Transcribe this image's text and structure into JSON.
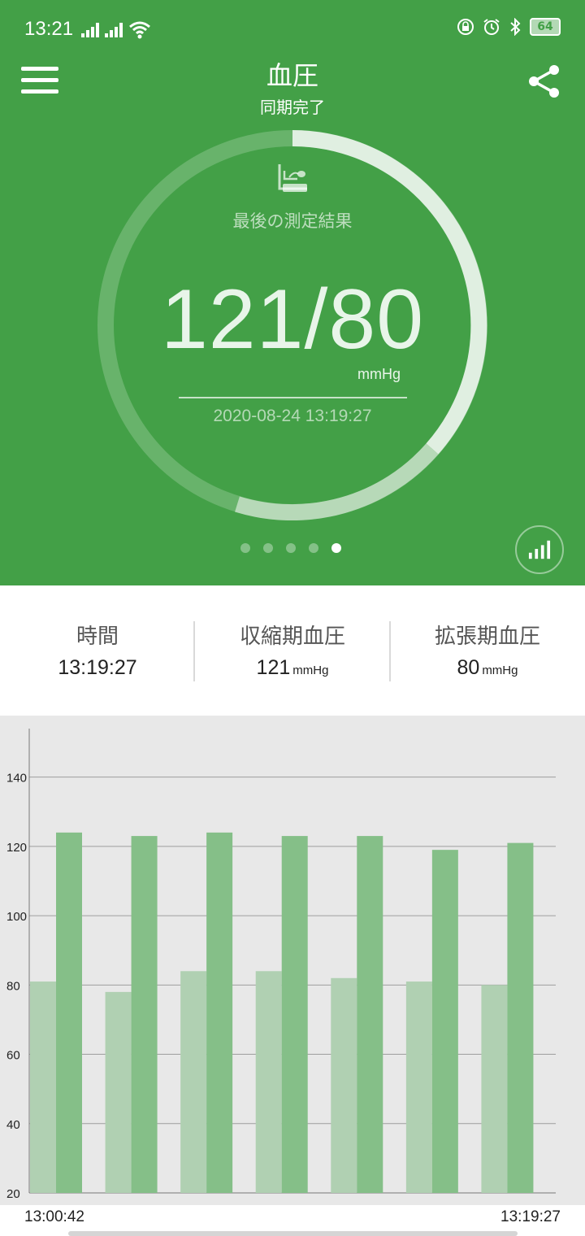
{
  "status_bar": {
    "time": "13:21",
    "battery": "64",
    "icons": [
      "signal-icon",
      "signal-icon",
      "wifi-icon",
      "lock-rotation-icon",
      "alarm-icon",
      "bluetooth-icon"
    ]
  },
  "header": {
    "title": "血圧",
    "subtitle": "同期完了",
    "menu_icon": "hamburger-icon",
    "share_icon": "share-icon"
  },
  "gauge": {
    "label": "最後の測定結果",
    "value": "121/80",
    "unit": "mmHg",
    "datetime": "2020-08-24 13:19:27",
    "icon": "blood-pressure-icon"
  },
  "pager": {
    "count": 5,
    "active_index": 4
  },
  "summary": {
    "time_label": "時間",
    "time_value": "13:19:27",
    "systolic_label": "収縮期血圧",
    "systolic_value": "121",
    "systolic_unit": "mmHg",
    "diastolic_label": "拡張期血圧",
    "diastolic_value": "80",
    "diastolic_unit": "mmHg"
  },
  "colors": {
    "primary_green": "#43a047",
    "systolic_bar": "#85bf88",
    "diastolic_bar": "#b0d0b2",
    "chart_bg": "#e8e8e8"
  },
  "chart_data": {
    "type": "bar",
    "x_start_label": "13:00:42",
    "x_end_label": "13:19:27",
    "ylim": [
      20,
      154
    ],
    "yticks": [
      20,
      40,
      60,
      80,
      100,
      120,
      140
    ],
    "grid": true,
    "series": [
      {
        "values": [
          81,
          78,
          84,
          84,
          82,
          81,
          80
        ]
      },
      {
        "values": [
          124,
          123,
          124,
          123,
          123,
          119,
          121
        ]
      }
    ]
  }
}
